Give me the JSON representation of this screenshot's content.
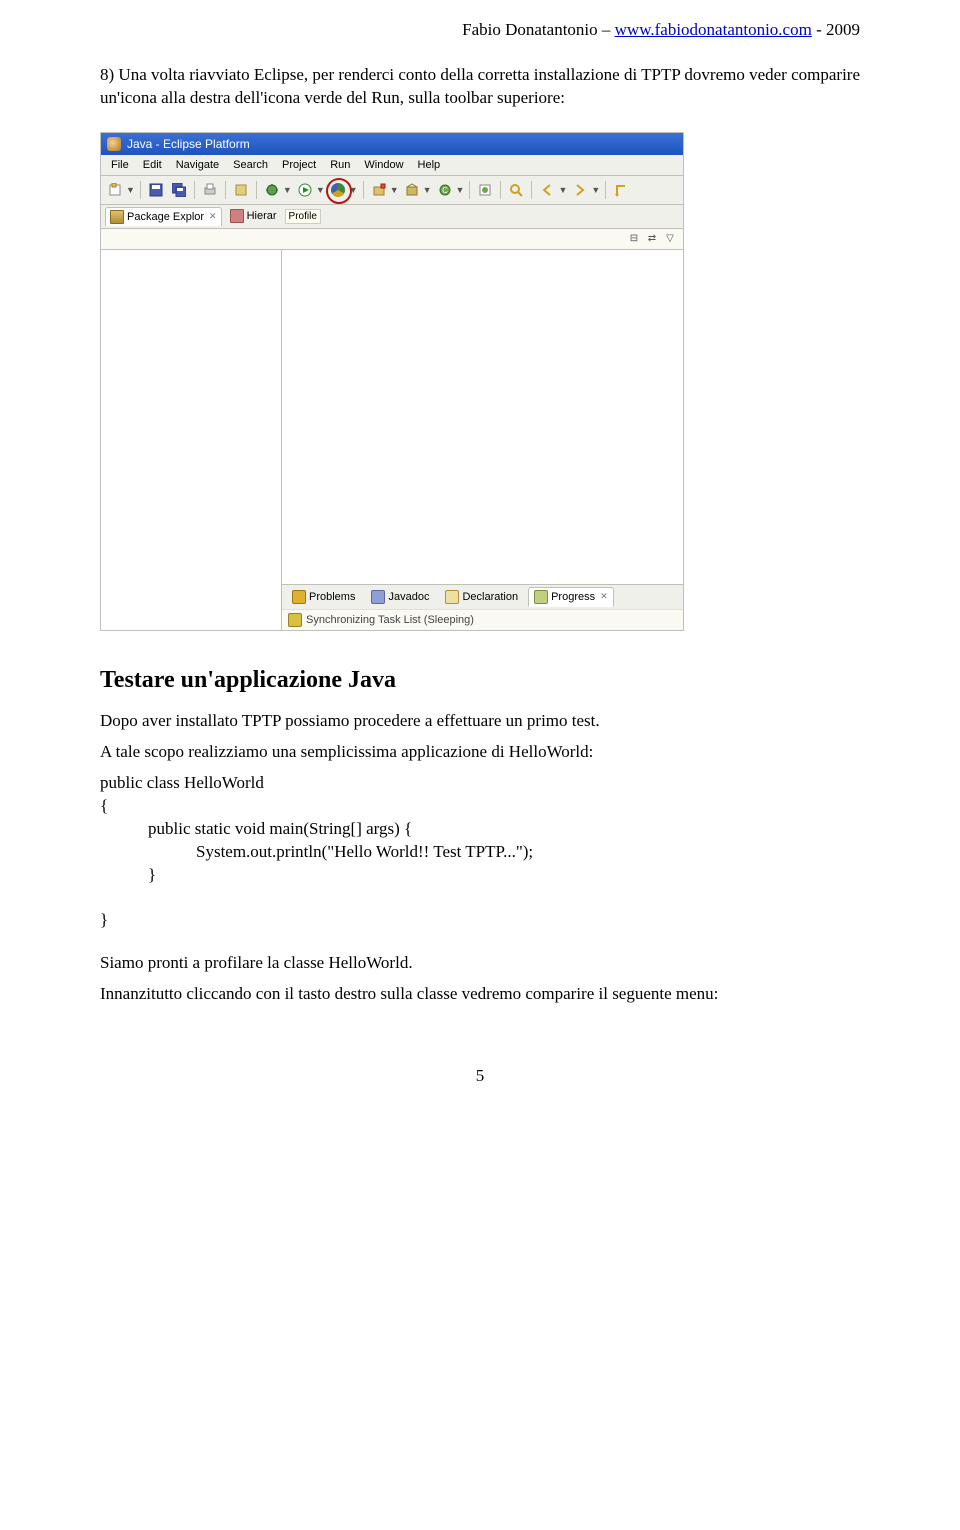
{
  "header": {
    "author": "Fabio Donatantonio – ",
    "link": "www.fabiodonatantonio.com",
    "year": " - 2009"
  },
  "para1": "8) Una volta riavviato Eclipse, per renderci conto della corretta installazione di TPTP dovremo veder comparire un'icona alla destra dell'icona verde del Run, sulla toolbar superiore:",
  "eclipse": {
    "title": "Java - Eclipse Platform",
    "menus": [
      "File",
      "Edit",
      "Navigate",
      "Search",
      "Project",
      "Run",
      "Window",
      "Help"
    ],
    "profile_tooltip": "Profile",
    "left_tabs": {
      "package": "Package Explor",
      "hierar": "Hierar"
    },
    "bottom_tabs": [
      "Problems",
      "Javadoc",
      "Declaration",
      "Progress"
    ],
    "status": "Synchronizing Task List (Sleeping)"
  },
  "section_title": "Testare un'applicazione Java",
  "para2": "Dopo aver installato TPTP possiamo procedere a effettuare un primo test.",
  "para3": "A tale scopo realizziamo una semplicissima applicazione di HelloWorld:",
  "code": {
    "l1": "public class HelloWorld",
    "l2": "{",
    "l3": "public static void main(String[] args) {",
    "l4": "System.out.println(\"Hello World!! Test TPTP...\");",
    "l5": "}",
    "l6": "}"
  },
  "para4": "Siamo pronti a profilare la classe HelloWorld.",
  "para5": "Innanzitutto cliccando con il tasto destro sulla classe vedremo comparire il seguente menu:",
  "pagenum": "5"
}
